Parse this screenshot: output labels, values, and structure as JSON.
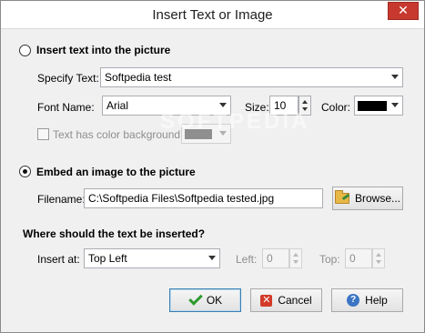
{
  "window": {
    "title": "Insert Text or Image",
    "close_glyph": "✕"
  },
  "text_section": {
    "radio_label": "Insert text into the picture",
    "selected": false,
    "specify_label": "Specify Text:",
    "specify_value": "Softpedia test",
    "font_label": "Font Name:",
    "font_value": "Arial",
    "size_label": "Size:",
    "size_value": "10",
    "color_label": "Color:",
    "color_value": "#000000",
    "bg_checkbox_label": "Text has color background:",
    "bg_checked": false,
    "bg_color_value": "#8f8f8f"
  },
  "image_section": {
    "radio_label": "Embed an image to the picture",
    "selected": true,
    "filename_label": "Filename:",
    "filename_value": "C:\\Softpedia Files\\Softpedia tested.jpg",
    "browse_label": "Browse..."
  },
  "position_section": {
    "heading": "Where should the text be inserted?",
    "insert_at_label": "Insert at:",
    "insert_at_value": "Top Left",
    "left_label": "Left:",
    "left_value": "0",
    "top_label": "Top:",
    "top_value": "0"
  },
  "buttons": {
    "ok": "OK",
    "cancel": "Cancel",
    "help": "Help"
  },
  "watermark": "SOFTPEDIA"
}
